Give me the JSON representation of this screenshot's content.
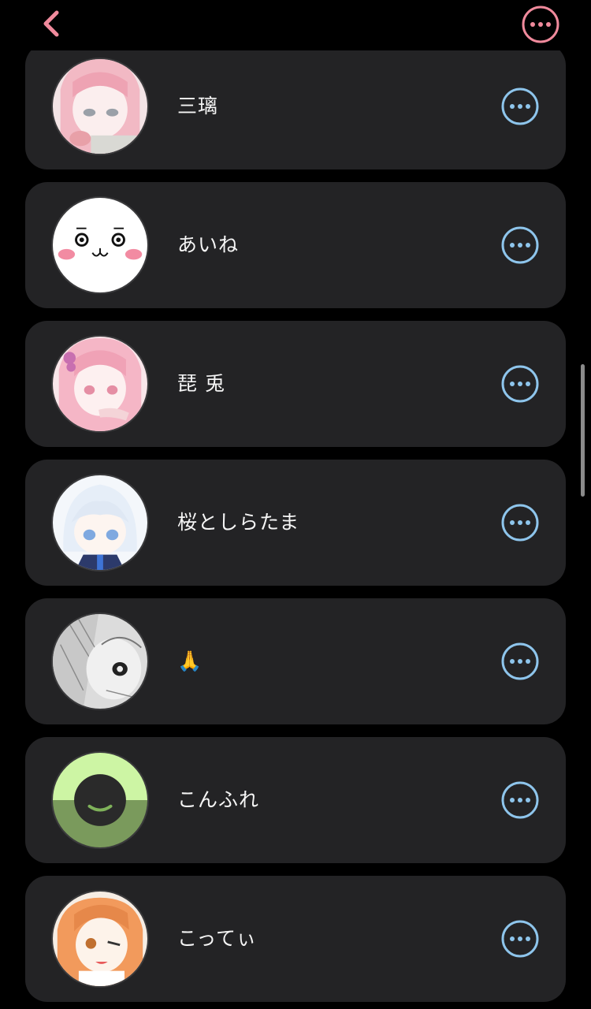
{
  "header": {
    "back_icon": "chevron-left-icon",
    "more_icon": "more-horizontal-circle-icon",
    "accent_color": "#f08a9c"
  },
  "list": {
    "action_color": "#8ec5ec",
    "items": [
      {
        "name": "三璃",
        "avatar": "pink-hair-girl-avatar"
      },
      {
        "name": "あいね",
        "avatar": "white-face-mascot-avatar"
      },
      {
        "name": " 琵 兎",
        "avatar": "pink-hair-girl-avatar"
      },
      {
        "name": "桜としらたま",
        "avatar": "white-hair-boy-avatar"
      },
      {
        "name": "🙏",
        "avatar": "sketch-girl-avatar"
      },
      {
        "name": "こんふれ",
        "avatar": "green-smile-ring-avatar"
      },
      {
        "name": "こってぃ",
        "avatar": "orange-hair-girl-avatar"
      }
    ]
  }
}
